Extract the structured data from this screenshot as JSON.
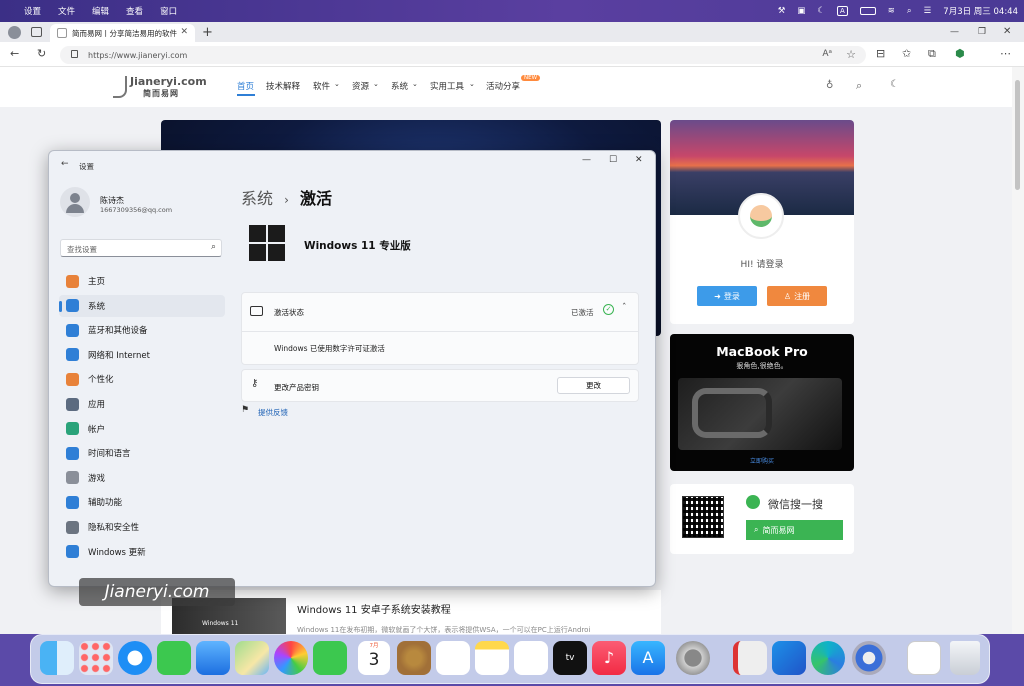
{
  "menubar": {
    "items": [
      "设置",
      "文件",
      "编辑",
      "查看",
      "窗口"
    ],
    "datetime": "7月3日 周三  04:44",
    "input_badge": "A"
  },
  "browser": {
    "tab_title": "简而易网丨分享简洁易用的软件",
    "url": "https://www.jianeryi.com"
  },
  "site": {
    "logo_text": "Jianeryi.com",
    "logo_sub": "简而易网",
    "nav": [
      "首页",
      "技术解释",
      "软件",
      "资源",
      "系统",
      "实用工具",
      "活动分享"
    ],
    "nav_badge": "NEW",
    "login_greeting": "HI! 请登录",
    "login_button": "登录",
    "register_button": "注册",
    "macbook_title": "MacBook Pro",
    "macbook_subtitle": "狠角色,很绝色。",
    "macbook_link": "立即购买",
    "wechat_title": "微信搜一搜",
    "wechat_search": "简而易网",
    "article_title": "Windows 11 安卓子系统安装教程",
    "article_excerpt": "Windows 11在发布初期，微软就画了个大饼，表示将提供WSA，一个可以在PC上运行Androi",
    "article_thumb_label": "Windows 11",
    "watermark": "Jianeryi.com"
  },
  "settings": {
    "window_title": "设置",
    "user_name": "陈诗杰",
    "user_email": "1667309356@qq.com",
    "search_placeholder": "查找设置",
    "sidebar": [
      {
        "label": "主页",
        "icon": "home-icon",
        "color": "#e8823a"
      },
      {
        "label": "系统",
        "icon": "system-icon",
        "color": "#2f7fd6"
      },
      {
        "label": "蓝牙和其他设备",
        "icon": "bluetooth-icon",
        "color": "#2f7fd6"
      },
      {
        "label": "网络和 Internet",
        "icon": "network-icon",
        "color": "#2f7fd6"
      },
      {
        "label": "个性化",
        "icon": "brush-icon",
        "color": "#e8823a"
      },
      {
        "label": "应用",
        "icon": "apps-icon",
        "color": "#5c6b80"
      },
      {
        "label": "帐户",
        "icon": "account-icon",
        "color": "#2aa37a"
      },
      {
        "label": "时间和语言",
        "icon": "time-language-icon",
        "color": "#2f7fd6"
      },
      {
        "label": "游戏",
        "icon": "gaming-icon",
        "color": "#8a8f99"
      },
      {
        "label": "辅助功能",
        "icon": "accessibility-icon",
        "color": "#2f7fd6"
      },
      {
        "label": "隐私和安全性",
        "icon": "shield-icon",
        "color": "#6b7480"
      },
      {
        "label": "Windows 更新",
        "icon": "update-icon",
        "color": "#2f7fd6"
      }
    ],
    "selected_index": 1,
    "breadcrumb_parent": "系统",
    "breadcrumb_sep": "›",
    "breadcrumb_current": "激活",
    "edition": "Windows 11 专业版",
    "activation_label": "激活状态",
    "activation_status": "已激活",
    "activation_detail": "Windows 已使用数字许可证激活",
    "product_key_label": "更改产品密钥",
    "change_button": "更改",
    "feedback_link": "提供反馈"
  },
  "dock": {
    "calendar_month": "7月",
    "calendar_day": "3"
  },
  "colors": {
    "accent": "#2f7fd6",
    "login": "#3d9be9",
    "register": "#f0883e",
    "wechat": "#3bb453",
    "activated": "#3bb453"
  }
}
